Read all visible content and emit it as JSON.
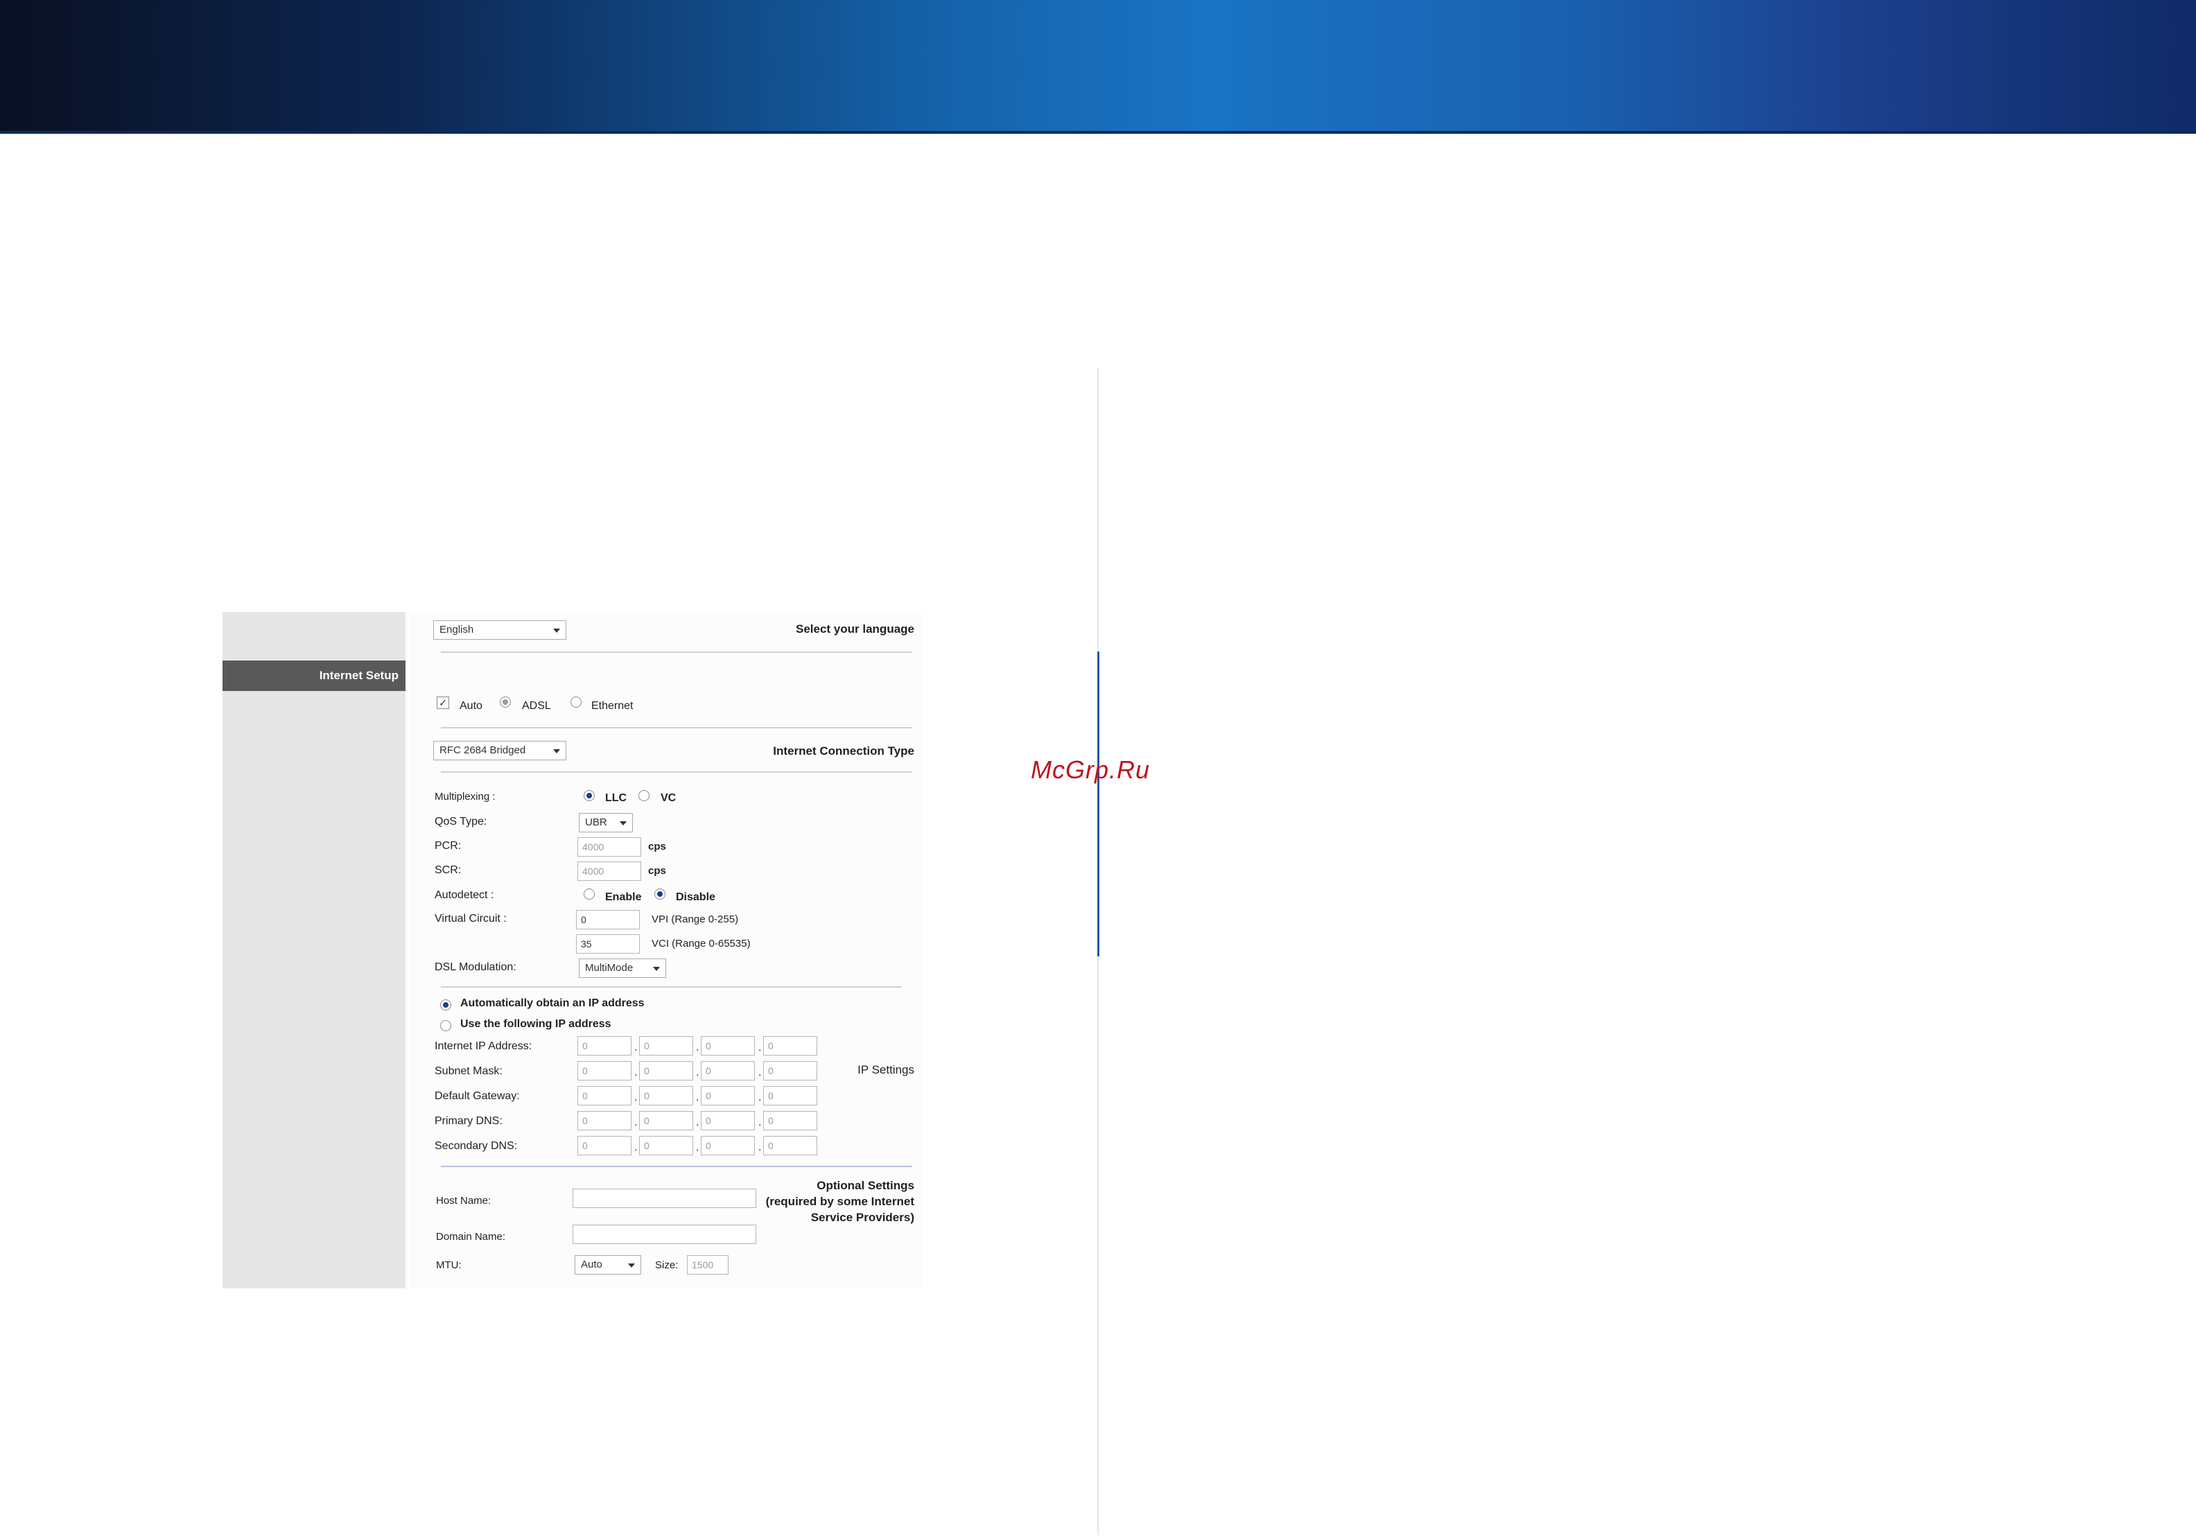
{
  "watermark": "McGrp.Ru",
  "settings": {
    "side": {
      "select_language": "Select your language",
      "internet_setup": "Internet Setup",
      "connection_type": "Internet Connection Type",
      "ip_settings": "IP Settings",
      "optional_line1": "Optional Settings",
      "optional_line2": "(required by some Internet",
      "optional_line3": "Service Providers)"
    },
    "language": "English",
    "mode": {
      "auto_label": "Auto",
      "adsl_label": "ADSL",
      "ethernet_label": "Ethernet",
      "auto_checked": true,
      "selected": "ADSL"
    },
    "connection_type": "RFC 2684 Bridged",
    "multiplexing": {
      "label": "Multiplexing :",
      "llc": "LLC",
      "vc": "VC",
      "selected": "LLC"
    },
    "qos": {
      "label": "QoS Type:",
      "value": "UBR"
    },
    "pcr": {
      "label": "PCR:",
      "value": "4000",
      "unit": "cps"
    },
    "scr": {
      "label": "SCR:",
      "value": "4000",
      "unit": "cps"
    },
    "autodetect": {
      "label": "Autodetect :",
      "enable": "Enable",
      "disable": "Disable",
      "selected": "Disable"
    },
    "virtual_circuit": {
      "label": "Virtual Circuit :",
      "vpi_value": "0",
      "vpi_label": "VPI (Range 0-255)",
      "vci_value": "35",
      "vci_label": "VCI (Range 0-65535)"
    },
    "dsl_modulation": {
      "label": "DSL Modulation:",
      "value": "MultiMode"
    },
    "ip": {
      "auto_label": "Automatically obtain an IP address",
      "manual_label": "Use the following IP address",
      "selected": "auto",
      "rows": [
        {
          "label": "Internet IP Address:",
          "octets": [
            "0",
            "0",
            "0",
            "0"
          ]
        },
        {
          "label": "Subnet Mask:",
          "octets": [
            "0",
            "0",
            "0",
            "0"
          ]
        },
        {
          "label": "Default Gateway:",
          "octets": [
            "0",
            "0",
            "0",
            "0"
          ]
        },
        {
          "label": "Primary DNS:",
          "octets": [
            "0",
            "0",
            "0",
            "0"
          ]
        },
        {
          "label": "Secondary DNS:",
          "octets": [
            "0",
            "0",
            "0",
            "0"
          ]
        }
      ],
      "separator": "."
    },
    "optional": {
      "host_label": "Host Name:",
      "host_value": "",
      "domain_label": "Domain Name:",
      "domain_value": "",
      "mtu_label": "MTU:",
      "mtu_value": "Auto",
      "size_label": "Size:",
      "size_value": "1500"
    }
  }
}
